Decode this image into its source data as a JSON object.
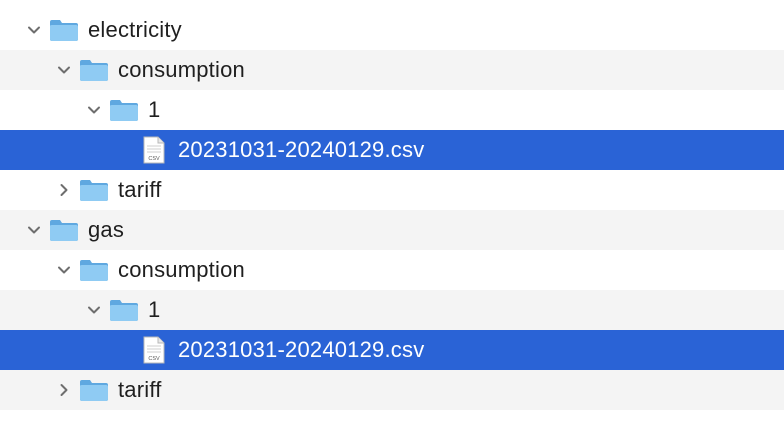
{
  "icons": {
    "folder": "folder-icon",
    "file": "csv-file-icon",
    "expanded": "chevron-down-icon",
    "collapsed": "chevron-right-icon"
  },
  "colors": {
    "selection": "#2a63d6",
    "alt_row": "#f4f4f4",
    "folder_blue": "#7cc0ee"
  },
  "tree": [
    {
      "label": "electricity",
      "type": "folder",
      "depth": 0,
      "expanded": true,
      "selected": false
    },
    {
      "label": "consumption",
      "type": "folder",
      "depth": 1,
      "expanded": true,
      "selected": false
    },
    {
      "label": "1",
      "type": "folder",
      "depth": 2,
      "expanded": true,
      "selected": false
    },
    {
      "label": "20231031-20240129.csv",
      "type": "file",
      "depth": 3,
      "selected": true,
      "file_badge": "CSV"
    },
    {
      "label": "tariff",
      "type": "folder",
      "depth": 1,
      "expanded": false,
      "selected": false
    },
    {
      "label": "gas",
      "type": "folder",
      "depth": 0,
      "expanded": true,
      "selected": false
    },
    {
      "label": "consumption",
      "type": "folder",
      "depth": 1,
      "expanded": true,
      "selected": false
    },
    {
      "label": "1",
      "type": "folder",
      "depth": 2,
      "expanded": true,
      "selected": false
    },
    {
      "label": "20231031-20240129.csv",
      "type": "file",
      "depth": 3,
      "selected": true,
      "file_badge": "CSV"
    },
    {
      "label": "tariff",
      "type": "folder",
      "depth": 1,
      "expanded": false,
      "selected": false
    }
  ]
}
